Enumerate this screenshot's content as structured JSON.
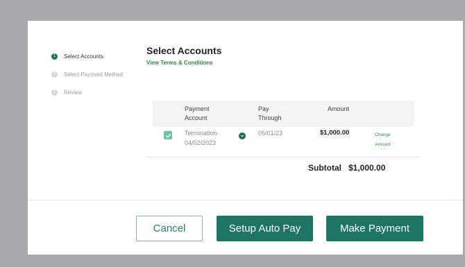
{
  "steps": [
    {
      "num": "1",
      "label": "Select Accounts",
      "active": true
    },
    {
      "num": "2",
      "label": "Select Payment Method",
      "active": false
    },
    {
      "num": "3",
      "label": "Review",
      "active": false
    }
  ],
  "header": {
    "title": "Select Accounts",
    "terms_link": "View Terms & Conditions"
  },
  "table": {
    "columns": [
      "Payment Account",
      "Pay Through",
      "Amount"
    ],
    "col_payment_line1": "Payment",
    "col_payment_line2": "Account",
    "col_pay_line1": "Pay",
    "col_pay_line2": "Through",
    "col_amount": "Amount",
    "row": {
      "checked": true,
      "account_line1": "Termination-",
      "account_line2": "04/02/2023",
      "pay_through": "05/01/23",
      "amount": "$1,000.00",
      "change_line1": "Change",
      "change_line2": "Amount"
    }
  },
  "subtotal": {
    "label": "Subtotal",
    "value": "$1,000.00"
  },
  "buttons": {
    "cancel": "Cancel",
    "setup_auto_pay": "Setup Auto Pay",
    "make_payment": "Make Payment"
  },
  "colors": {
    "primary": "#1e7564",
    "link": "#2e8a3e",
    "checkbox": "#6cc6a0",
    "backdrop": "#a7a9ac"
  }
}
